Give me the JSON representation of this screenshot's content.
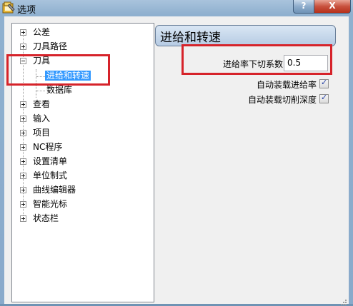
{
  "window": {
    "title": "选项",
    "help_glyph": "?",
    "close_glyph": "X"
  },
  "tree": {
    "items": [
      {
        "label": "公差",
        "expander": "+"
      },
      {
        "label": "刀具路径",
        "expander": "+"
      },
      {
        "label": "刀具",
        "expander": "-"
      },
      {
        "label": "进给和转速",
        "selected": true
      },
      {
        "label": "数据库"
      },
      {
        "label": "查看",
        "expander": "+"
      },
      {
        "label": "输入",
        "expander": "+"
      },
      {
        "label": "项目",
        "expander": "+"
      },
      {
        "label": "NC程序",
        "expander": "+"
      },
      {
        "label": "设置清单",
        "expander": "+"
      },
      {
        "label": "单位制式",
        "expander": "+"
      },
      {
        "label": "曲线编辑器",
        "expander": "+"
      },
      {
        "label": "智能光标",
        "expander": "+"
      },
      {
        "label": "状态栏",
        "expander": "+"
      }
    ]
  },
  "panel": {
    "header": "进给和转速",
    "plunge_factor_label": "进给率下切系数",
    "plunge_factor_value": "0.5",
    "auto_load_feed_label": "自动装载进给率",
    "auto_load_feed_checked": true,
    "auto_load_depth_label": "自动装载切削深度",
    "auto_load_depth_checked": true
  }
}
